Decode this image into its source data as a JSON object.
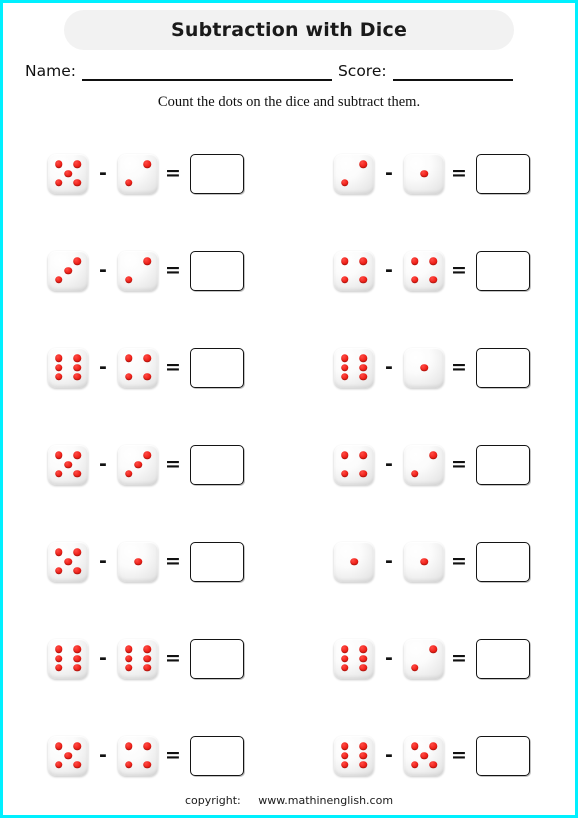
{
  "header": {
    "title": "Subtraction with Dice",
    "name_label": "Name:",
    "score_label": "Score:",
    "instruction": "Count the dots on the dice and subtract them."
  },
  "symbols": {
    "minus": "-",
    "equals": "="
  },
  "colors": {
    "page_border": "#00f0ff",
    "title_bar_bg": "#f2f2f2",
    "pip_red": "#ef2018",
    "die_face": "#f7f7f7",
    "ink": "#111111"
  },
  "problems": [
    {
      "row": 1,
      "side": "left",
      "minuend": 5,
      "subtrahend": 2,
      "answer": ""
    },
    {
      "row": 1,
      "side": "right",
      "minuend": 2,
      "subtrahend": 1,
      "answer": ""
    },
    {
      "row": 2,
      "side": "left",
      "minuend": 3,
      "subtrahend": 2,
      "answer": ""
    },
    {
      "row": 2,
      "side": "right",
      "minuend": 4,
      "subtrahend": 4,
      "answer": ""
    },
    {
      "row": 3,
      "side": "left",
      "minuend": 6,
      "subtrahend": 4,
      "answer": ""
    },
    {
      "row": 3,
      "side": "right",
      "minuend": 6,
      "subtrahend": 1,
      "answer": ""
    },
    {
      "row": 4,
      "side": "left",
      "minuend": 5,
      "subtrahend": 3,
      "answer": ""
    },
    {
      "row": 4,
      "side": "right",
      "minuend": 4,
      "subtrahend": 2,
      "answer": ""
    },
    {
      "row": 5,
      "side": "left",
      "minuend": 5,
      "subtrahend": 1,
      "answer": ""
    },
    {
      "row": 5,
      "side": "right",
      "minuend": 1,
      "subtrahend": 1,
      "answer": ""
    },
    {
      "row": 6,
      "side": "left",
      "minuend": 6,
      "subtrahend": 6,
      "answer": ""
    },
    {
      "row": 6,
      "side": "right",
      "minuend": 6,
      "subtrahend": 2,
      "answer": ""
    },
    {
      "row": 7,
      "side": "left",
      "minuend": 5,
      "subtrahend": 4,
      "answer": ""
    },
    {
      "row": 7,
      "side": "right",
      "minuend": 6,
      "subtrahend": 5,
      "answer": ""
    }
  ],
  "footer": {
    "copyright_label": "copyright:",
    "site": "www.mathinenglish.com"
  }
}
